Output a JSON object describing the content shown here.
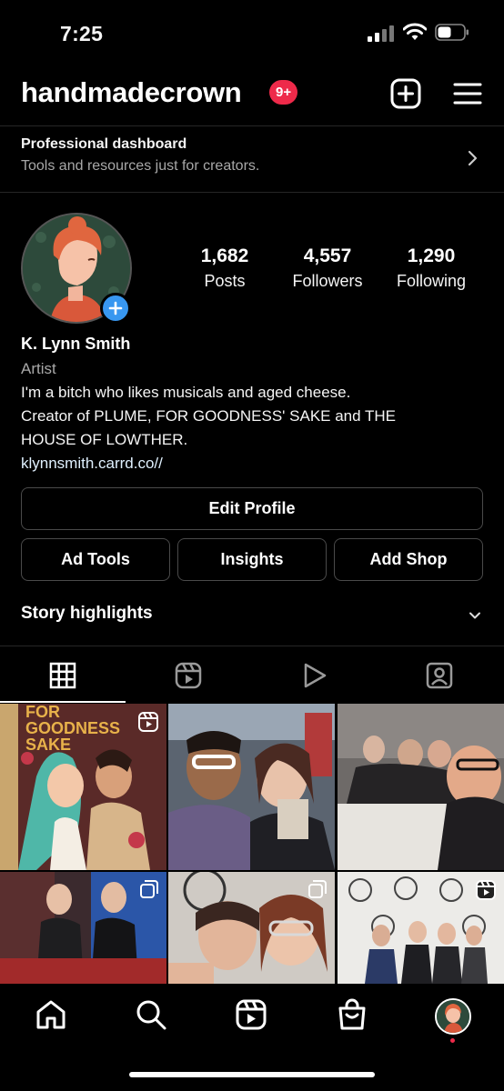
{
  "status_bar": {
    "time": "7:25"
  },
  "header": {
    "username": "handmadecrown",
    "notification_badge": "9+"
  },
  "dashboard": {
    "title": "Professional dashboard",
    "subtitle": "Tools and resources just for creators."
  },
  "stats": [
    {
      "value": "1,682",
      "label": "Posts"
    },
    {
      "value": "4,557",
      "label": "Followers"
    },
    {
      "value": "1,290",
      "label": "Following"
    }
  ],
  "bio": {
    "name": "K. Lynn Smith",
    "category": "Artist",
    "lines": [
      "I'm a bitch who likes musicals and aged cheese.",
      "Creator of PLUME, FOR GOODNESS' SAKE and THE",
      "HOUSE OF LOWTHER."
    ],
    "link": "klynnsmith.carrd.co//"
  },
  "buttons": {
    "edit_profile": "Edit Profile",
    "ad_tools": "Ad Tools",
    "insights": "Insights",
    "add_shop": "Add Shop"
  },
  "highlights": {
    "title": "Story highlights"
  },
  "tabs": [
    {
      "icon": "grid-icon",
      "active": true
    },
    {
      "icon": "reels-icon",
      "active": false
    },
    {
      "icon": "play-icon",
      "active": false
    },
    {
      "icon": "tagged-icon",
      "active": false
    }
  ],
  "posts": [
    {
      "cover_text": "FOR GOODNESS SAKE",
      "type": "reel"
    },
    {
      "cover_text": "",
      "type": "photo"
    },
    {
      "cover_text": "",
      "type": "photo"
    },
    {
      "cover_text": "",
      "type": "carousel"
    },
    {
      "cover_text": "",
      "type": "carousel"
    },
    {
      "cover_text": "",
      "type": "reel"
    }
  ],
  "bottom_nav": [
    "home-icon",
    "search-icon",
    "reels-icon",
    "shop-icon",
    "profile-avatar"
  ],
  "colors": {
    "background": "#000000",
    "badge": "#ee2a4a",
    "plus_badge": "#3897f0",
    "muted_text": "#a8a8a8",
    "border": "#4a4a4a"
  }
}
